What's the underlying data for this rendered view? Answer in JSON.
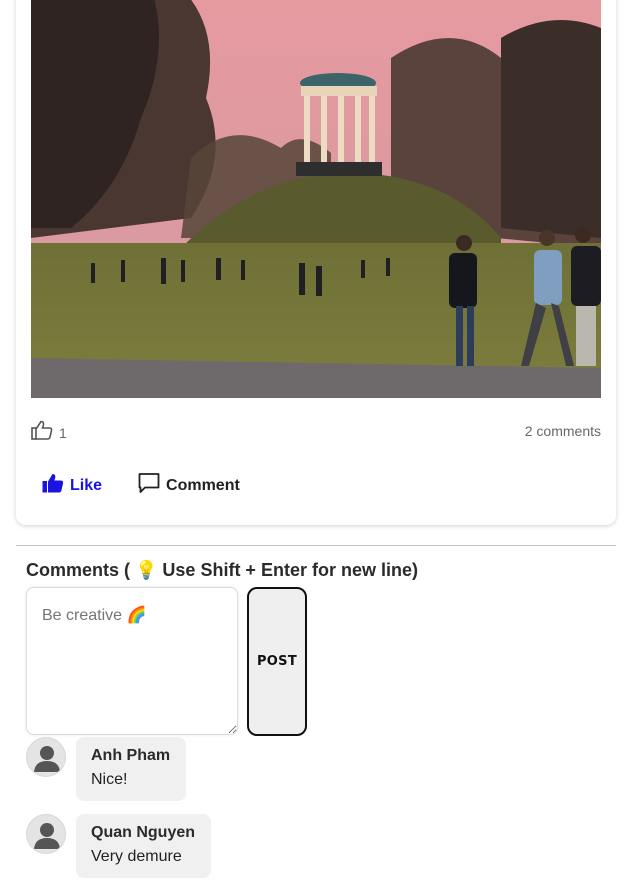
{
  "post": {
    "photo_alt": "",
    "likes_count": "1",
    "comments_count": "2 comments",
    "like_label": "Like",
    "comment_label": "Comment"
  },
  "comments_section": {
    "heading": "Comments ( 💡 Use Shift + Enter for new line)",
    "input_placeholder": "Be creative 🌈",
    "post_button_label": "POST"
  },
  "comments": [
    {
      "author": "Anh Pham",
      "text": "Nice!"
    },
    {
      "author": "Quan Nguyen",
      "text": "Very demure"
    }
  ],
  "colors": {
    "like_accent": "#1a14e0",
    "sky": "#e8a0a4"
  }
}
